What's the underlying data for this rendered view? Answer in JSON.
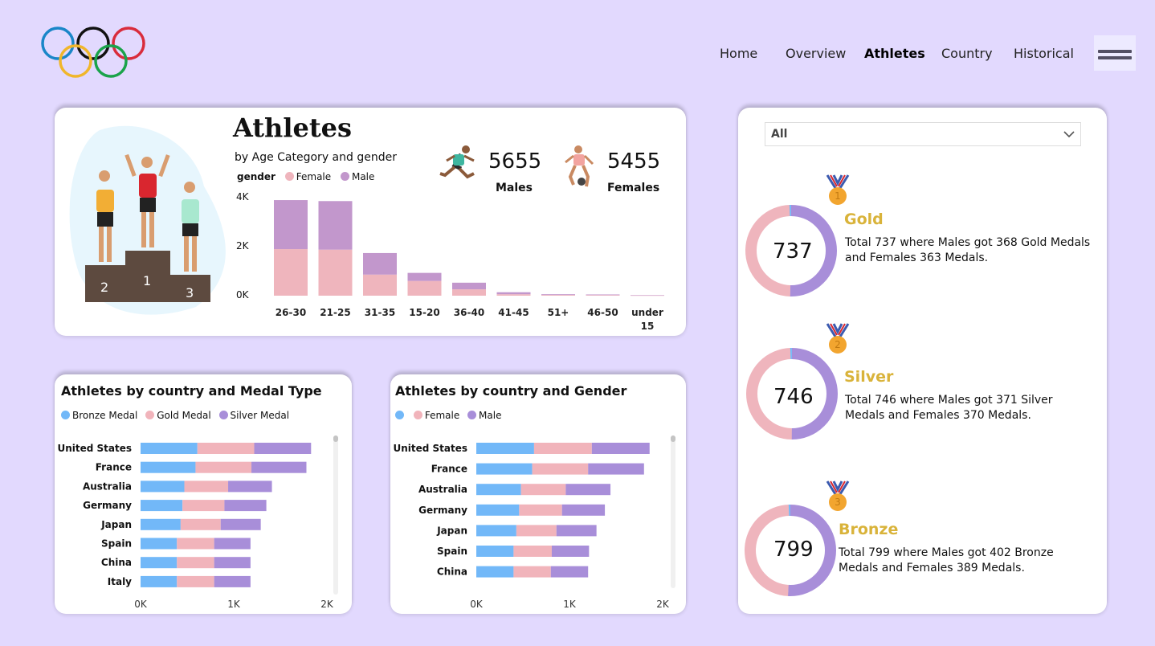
{
  "nav": {
    "items": [
      {
        "label": "Home",
        "active": false
      },
      {
        "label": "Overview",
        "active": false
      },
      {
        "label": "Athletes",
        "active": true
      },
      {
        "label": "Country",
        "active": false
      },
      {
        "label": "Historical",
        "active": false
      }
    ],
    "menu_icon": "hamburger-icon",
    "logo_icon": "olympic-rings-icon"
  },
  "colors": {
    "background": "#e2d9fe",
    "female": "#efb5bd",
    "male": "#c297cc",
    "bronze": "#72b8f8",
    "gold_bar": "#f1b4bb",
    "silver": "#a88ed9",
    "medal_text": "#d9b33a"
  },
  "athletes_card": {
    "title": "Athletes",
    "subtitle": "by Age Category and gender",
    "legend_title": "gender",
    "legend": [
      "Female",
      "Male"
    ],
    "y_ticks": [
      "4K",
      "2K",
      "0K"
    ],
    "podium_labels": [
      "2",
      "1",
      "3"
    ],
    "kpis": {
      "males_value": "5655",
      "males_label": "Males",
      "females_value": "5455",
      "females_label": "Females"
    }
  },
  "chart_data": [
    {
      "type": "bar",
      "stacked": true,
      "title": "Athletes",
      "subtitle": "by Age Category and gender",
      "categories": [
        "26-30",
        "21-25",
        "31-35",
        "15-20",
        "36-40",
        "41-45",
        "51+",
        "46-50",
        "under 15"
      ],
      "series": [
        {
          "name": "Female",
          "values": [
            1900,
            1880,
            860,
            600,
            260,
            60,
            30,
            25,
            10
          ]
        },
        {
          "name": "Male",
          "values": [
            2000,
            1980,
            880,
            330,
            270,
            80,
            30,
            25,
            15
          ]
        }
      ],
      "ylim": [
        0,
        4000
      ],
      "y_ticks": [
        "4K",
        "2K",
        "0K"
      ],
      "legend_title": "gender"
    },
    {
      "type": "bar",
      "orientation": "horizontal",
      "stacked": true,
      "title": "Athletes by country and Medal Type",
      "categories": [
        "United States",
        "France",
        "Australia",
        "Germany",
        "Japan",
        "Spain",
        "China",
        "Italy"
      ],
      "series": [
        {
          "name": "Bronze Medal",
          "values": [
            610,
            590,
            470,
            450,
            430,
            390,
            390,
            390
          ]
        },
        {
          "name": "Gold Medal",
          "values": [
            610,
            600,
            470,
            450,
            430,
            400,
            400,
            400
          ]
        },
        {
          "name": "Silver Medal",
          "values": [
            610,
            590,
            470,
            450,
            430,
            390,
            390,
            390
          ]
        }
      ],
      "xlim": [
        0,
        2000
      ],
      "x_ticks": [
        "0K",
        "1K",
        "2K"
      ]
    },
    {
      "type": "bar",
      "orientation": "horizontal",
      "stacked": true,
      "title": "Athletes by country and Gender",
      "categories": [
        "United States",
        "France",
        "Australia",
        "Germany",
        "Japan",
        "Spain",
        "China"
      ],
      "series": [
        {
          "name": "",
          "values": [
            620,
            600,
            480,
            460,
            430,
            400,
            400
          ]
        },
        {
          "name": "Female",
          "values": [
            620,
            600,
            480,
            460,
            430,
            410,
            400
          ]
        },
        {
          "name": "Male",
          "values": [
            620,
            600,
            480,
            460,
            430,
            400,
            400
          ]
        }
      ],
      "xlim": [
        0,
        2000
      ],
      "x_ticks": [
        "0K",
        "1K",
        "2K"
      ]
    },
    {
      "type": "pie",
      "title": "Gold",
      "labels": [
        "Males",
        "Females"
      ],
      "values": [
        368,
        363
      ],
      "center_label": "737"
    },
    {
      "type": "pie",
      "title": "Silver",
      "labels": [
        "Males",
        "Females"
      ],
      "values": [
        371,
        370
      ],
      "center_label": "746"
    },
    {
      "type": "pie",
      "title": "Bronze",
      "labels": [
        "Males",
        "Females"
      ],
      "values": [
        402,
        389
      ],
      "center_label": "799"
    }
  ],
  "medal_chart": {
    "title": "Athletes by country and Medal Type",
    "legend": [
      "Bronze Medal",
      "Gold Medal",
      "Silver Medal"
    ],
    "countries": [
      "United States",
      "France",
      "Australia",
      "Germany",
      "Japan",
      "Spain",
      "China",
      "Italy"
    ],
    "x_ticks": [
      "0K",
      "1K",
      "2K"
    ]
  },
  "gender_chart": {
    "title": "Athletes by country and Gender",
    "legend": [
      "",
      "Female",
      "Male"
    ],
    "countries": [
      "United States",
      "France",
      "Australia",
      "Germany",
      "Japan",
      "Spain",
      "China"
    ],
    "x_ticks": [
      "0K",
      "1K",
      "2K"
    ]
  },
  "medals_panel": {
    "filter_value": "All",
    "gold": {
      "total": "737",
      "name": "Gold",
      "desc": "Total 737 where Males got 368 Gold Medals and Females 363 Medals.",
      "icon": "gold-medal-icon"
    },
    "silver": {
      "total": "746",
      "name": "Silver",
      "desc": "Total 746 where Males got 371 Silver Medals and Females 370 Medals.",
      "icon": "silver-medal-icon"
    },
    "bronze": {
      "total": "799",
      "name": "Bronze",
      "desc": "Total 799 where Males got 402 Bronze Medals and Females 389 Medals.",
      "icon": "bronze-medal-icon"
    }
  }
}
